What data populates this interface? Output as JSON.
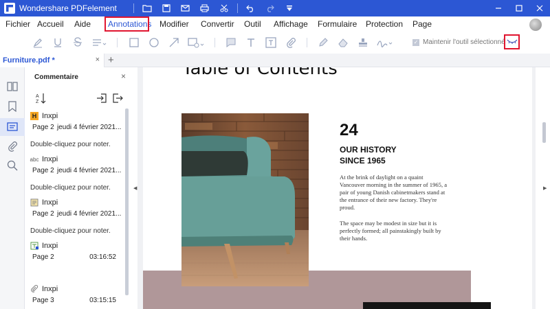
{
  "app": {
    "title": "Wondershare PDFelement",
    "quick_access_icons": [
      "folder-icon",
      "save-icon",
      "mail-icon",
      "print-icon",
      "scissors-icon",
      "undo-icon",
      "redo-icon",
      "customize-dropdown-icon"
    ],
    "window_controls": [
      "minimize-icon",
      "maximize-icon",
      "close-icon"
    ],
    "brand_color": "#2c57d4",
    "highlight_color": "#e0142f"
  },
  "menu": {
    "items": [
      "Fichier",
      "Accueil",
      "Aide",
      "Annotations",
      "Modifier",
      "Convertir",
      "Outil",
      "Affichage",
      "Formulaire",
      "Protection",
      "Page"
    ],
    "active": "Annotations"
  },
  "toolbar": {
    "keep_tool_label": "Maintenir l'outil sélectionné",
    "keep_tool_checked": true,
    "icons": [
      "highlight-icon",
      "underline-icon",
      "strikethrough-icon",
      "text-lines-icon",
      "rectangle-icon",
      "ellipse-icon",
      "arrow-icon",
      "shape-dropdown-icon",
      "sticky-note-icon",
      "typewriter-icon",
      "textbox-icon",
      "attachment-icon",
      "pencil-icon",
      "eraser-icon",
      "stamp-icon",
      "signature-icon",
      "hide-annotations-icon"
    ]
  },
  "tabs": {
    "file_name": "Furniture.pdf *",
    "close_glyph": "×",
    "add_glyph": "+"
  },
  "rail": {
    "icons": [
      "thumbnails-icon",
      "bookmark-icon",
      "comments-icon",
      "attachments-icon",
      "search-icon"
    ],
    "selected": "comments-icon"
  },
  "comment_panel": {
    "title": "Commentaire",
    "close_glyph": "×",
    "items": [
      {
        "icon": "highlight-comment-icon",
        "icon_text": "H",
        "author": "Inxpi",
        "page": "Page 2",
        "date": "jeudi 4 février 2021...",
        "note": "Double-cliquez pour noter."
      },
      {
        "icon": "strikeout-comment-icon",
        "icon_text": "abc",
        "author": "Inxpi",
        "page": "Page 2",
        "date": "jeudi 4 février 2021...",
        "note": "Double-cliquez pour noter."
      },
      {
        "icon": "note-comment-icon",
        "icon_text": "",
        "author": "Inxpi",
        "page": "Page 2",
        "date": "jeudi 4 février 2021...",
        "note": "Double-cliquez pour noter."
      },
      {
        "icon": "textbox-comment-icon",
        "icon_text": "",
        "author": "Inxpi",
        "page": "Page 2",
        "date": "03:16:52",
        "note": ""
      },
      {
        "icon": "attachment-comment-icon",
        "icon_text": "",
        "author": "Inxpi",
        "page": "Page 3",
        "date": "03:15:15",
        "note": ""
      }
    ]
  },
  "document": {
    "heading": "Table of Contents",
    "page_number": "24",
    "history_title": "OUR HISTORY SINCE 1965",
    "paragraph_1": "At the brink of daylight on a quaint Vancouver morning in the summer of 1965, a pair of young Danish cabinetmakers stand at the entrance of their new factory. They're proud.",
    "paragraph_2": "The space may be modest in size but it is perfectly formed; all painstakingly built by their hands.",
    "accent_band_color": "#b09799"
  }
}
